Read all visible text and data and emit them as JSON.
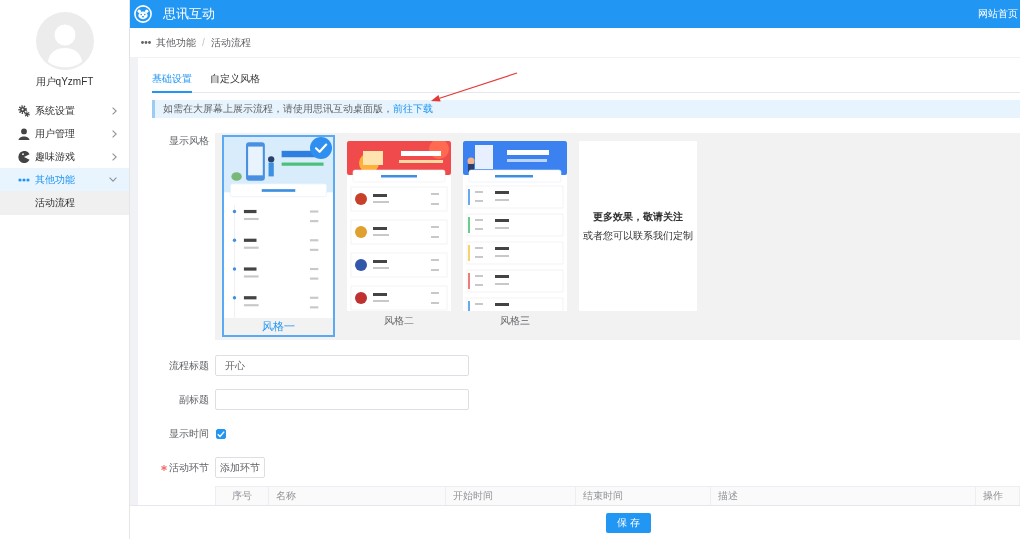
{
  "topbar": {
    "brand": "思讯互动",
    "links": [
      "网站首页"
    ]
  },
  "sidebar": {
    "username": "用户qYzmFT",
    "items": [
      {
        "label": "系统设置",
        "selected": false,
        "expanded": false
      },
      {
        "label": "用户管理",
        "selected": false,
        "expanded": false
      },
      {
        "label": "趣味游戏",
        "selected": false,
        "expanded": false
      },
      {
        "label": "其他功能",
        "selected": true,
        "expanded": true,
        "children": [
          {
            "label": "活动流程",
            "selected": true
          }
        ]
      }
    ]
  },
  "breadcrumb": {
    "items": [
      "其他功能",
      "活动流程"
    ],
    "separator": "/"
  },
  "tabs": [
    {
      "label": "基础设置",
      "selected": true
    },
    {
      "label": "自定义风格",
      "selected": false
    }
  ],
  "notice": {
    "text": "如需在大屏幕上展示流程，请使用思讯互动桌面版，",
    "link": "前往下载"
  },
  "style_picker": {
    "label": "显示风格",
    "options": [
      {
        "kind": "preview",
        "label": "风格一",
        "selected": true
      },
      {
        "kind": "preview",
        "label": "风格二",
        "selected": false
      },
      {
        "kind": "preview",
        "label": "风格三",
        "selected": false
      },
      {
        "kind": "more",
        "lines": [
          "更多效果，敬请关注",
          "或者您可以联系我们定制"
        ]
      }
    ]
  },
  "fields": [
    {
      "label": "流程标题",
      "value": "开心"
    },
    {
      "label": "副标题"
    }
  ],
  "show_time": {
    "label": "显示时间",
    "checked": true
  },
  "stages": {
    "label": "活动环节",
    "required": true,
    "button": "添加环节",
    "columns": [
      "序号",
      "名称",
      "开始时间",
      "结束时间",
      "描述",
      "操作"
    ]
  },
  "footer": {
    "button": "保存"
  }
}
